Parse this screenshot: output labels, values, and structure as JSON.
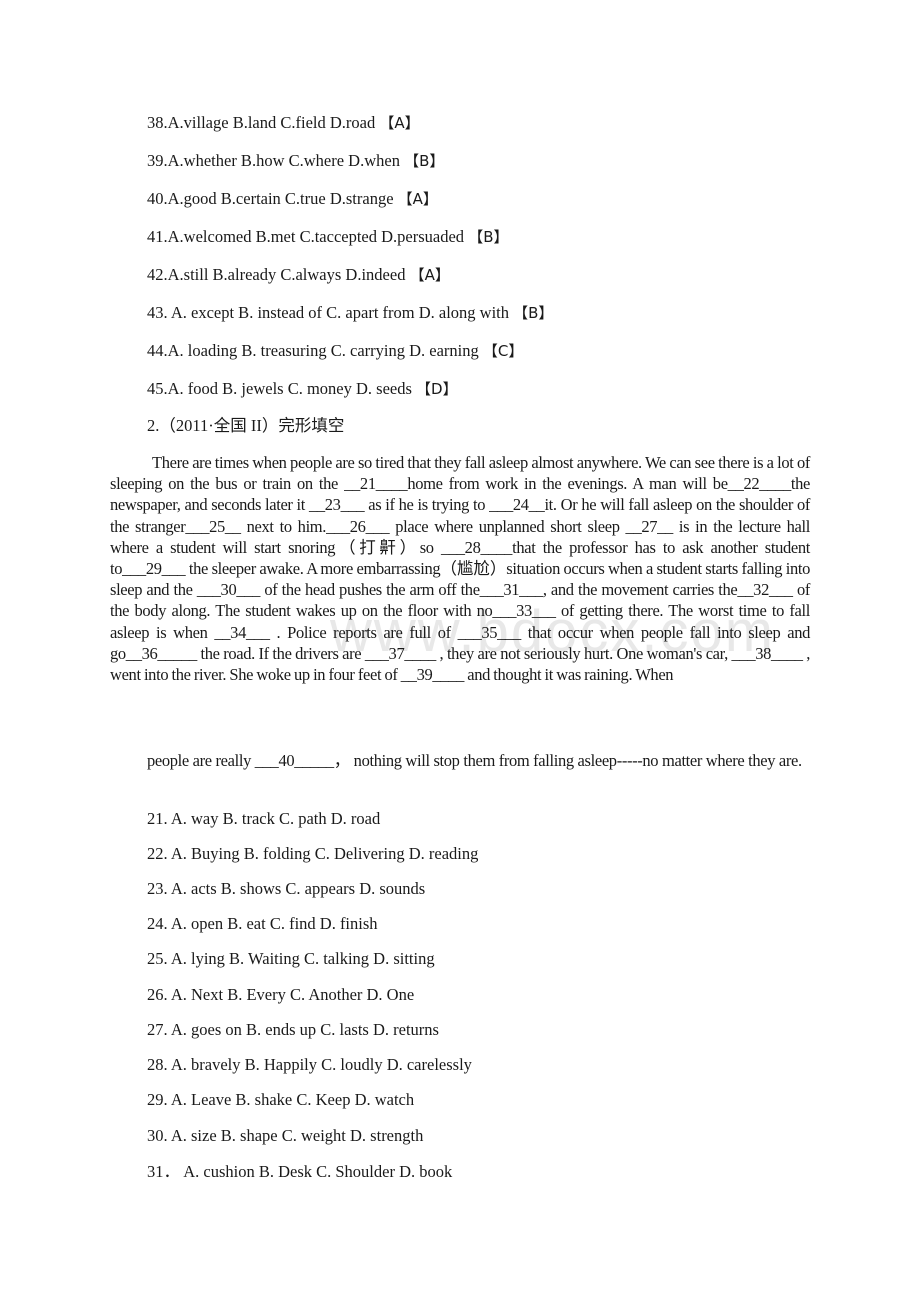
{
  "answered_questions": [
    {
      "text": "38.A.village B.land C.field D.road ",
      "answer": "【A】"
    },
    {
      "text": "39.A.whether B.how C.where D.when ",
      "answer": "【B】"
    },
    {
      "text": "40.A.good B.certain C.true D.strange ",
      "answer": "【A】"
    },
    {
      "text": "41.A.welcomed B.met C.taccepted D.persuaded ",
      "answer": "【B】"
    },
    {
      "text": "42.A.still B.already C.always D.indeed ",
      "answer": "【A】"
    },
    {
      "text": "43. A. except B. instead of C. apart from D. along with ",
      "answer": "【B】"
    },
    {
      "text": "44.A. loading B. treasuring C. carrying D. earning ",
      "answer": "【C】"
    },
    {
      "text": "45.A. food B. jewels C. money D. seeds ",
      "answer": "【D】"
    }
  ],
  "section_heading": "2.（2011·全国 II）完形填空",
  "passage": {
    "paragraph1": "There are times when people are so tired that they fall asleep almost anywhere. We can see there is a lot of sleeping on the bus or train on the __21____home from work in the evenings. A man will be__22____the newspaper, and seconds later it __23___ as if he is trying to ___24__it. Or he will fall asleep on the shoulder of the stranger___25__ next to him.___26___ place where unplanned short sleep __27__ is in the lecture hall where a student will start snoring（打鼾）so ___28____that the professor has to ask another student to___29___ the sleeper awake. A more embarrassing（尴尬）situation occurs when a student starts falling into sleep and the ___30___ of the head pushes the arm off the___31___, and the movement carries the__32___ of the body along. The student wakes up on the floor with no___33___ of getting there. The worst time to fall asleep is when __34___ . Police reports are full of ___35___ that occur when people fall into sleep and go__36_____ the road. If the drivers are ___37____ , they are not seriously hurt. One woman's car, ___38____ , went into the river. She woke up in four feet of __39____ and thought it was raining. When",
    "paragraph2": "people are really ___40_____，  nothing will stop them from falling asleep-----no matter where they are."
  },
  "options": [
    "21. A. way B. track C. path D. road",
    "22. A. Buying B. folding C. Delivering D. reading",
    "23. A. acts B. shows C. appears D. sounds",
    "24. A. open B. eat C. find D. finish",
    "25. A. lying B. Waiting C. talking D. sitting",
    "26. A. Next B. Every C. Another D. One",
    "27. A. goes on B. ends up C. lasts D. returns",
    "28. A. bravely B. Happily C. loudly D. carelessly",
    "29. A. Leave B. shake C. Keep D. watch",
    "30. A. size B. shape C. weight D. strength",
    "31．  A. cushion B. Desk C. Shoulder D. book"
  ],
  "watermark": "www.bdocx.com"
}
